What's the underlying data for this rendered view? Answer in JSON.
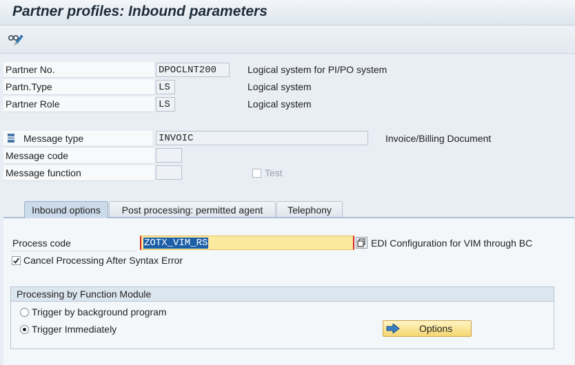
{
  "window": {
    "title": "Partner profiles: Inbound parameters"
  },
  "toolbar": {
    "edit_icon": "glasses-pencil-icon"
  },
  "header_fields": [
    {
      "label": "Partner No.",
      "value": "DPOCLNT200",
      "description": "Logical system for PI/PO system"
    },
    {
      "label": "Partn.Type",
      "value": "LS",
      "description": "Logical system"
    },
    {
      "label": "Partner Role",
      "value": "LS",
      "description": "Logical system"
    }
  ],
  "message": {
    "type_label": "Message type",
    "type_value": "INVOIC",
    "type_description": "Invoice/Billing Document",
    "code_label": "Message code",
    "code_value": "",
    "function_label": "Message function",
    "function_value": "",
    "test_label": "Test",
    "test_checked": false
  },
  "tabs": [
    {
      "label": "Inbound options",
      "active": true
    },
    {
      "label": "Post processing: permitted agent",
      "active": false
    },
    {
      "label": "Telephony",
      "active": false
    }
  ],
  "inbound": {
    "process_code_label": "Process code",
    "process_code_value": "ZOTX_VIM_RS",
    "process_code_description": "EDI Configuration for VIM through BC",
    "cancel_label": "Cancel Processing After Syntax Error",
    "cancel_checked": true,
    "group_title": "Processing by Function Module",
    "radio_background": "Trigger by background program",
    "radio_immediately": "Trigger Immediately",
    "selected_trigger": "Trigger Immediately",
    "options_button": "Options"
  },
  "colors": {
    "title_bg": "#dde5ee",
    "input_highlight": "#fbe9a0",
    "button_bg": "#f5d770",
    "arrow_icon": "#3a7fc4"
  }
}
